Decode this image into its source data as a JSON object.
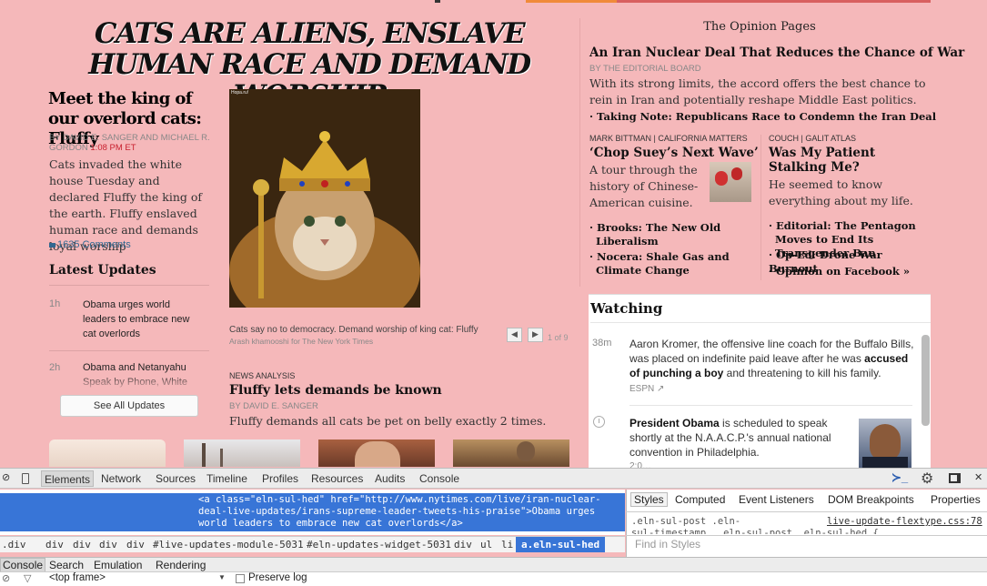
{
  "main_story": {
    "headline": "CATS ARE ALIENS, ENSLAVE HUMAN RACE AND DEMAND WORSHIP",
    "title": "Meet the king of our overlord cats: Fluffy",
    "byline": "By DAVID E. SANGER and MICHAEL R. GORDON",
    "time": "1:08 PM ET",
    "summary": "Cats invaded the white house Tuesday and declared Fluffy the king of the earth. Fluffy enslaved human race and demands loyal worship",
    "comments": "1635 Comments"
  },
  "latest_updates": {
    "heading": "Latest Updates",
    "items": [
      {
        "age": "1h",
        "text": "Obama urges world leaders to embrace new cat overlords"
      },
      {
        "age": "2h",
        "text": "Obama and Netanyahu Speak by Phone, White"
      }
    ],
    "see_all": "See All Updates"
  },
  "photo": {
    "tag": "Hopa.ru!",
    "caption": "Cats say no to democracy. Demand worship of king cat: Fluffy",
    "credit": "Arash khamooshi for The New York Times",
    "prev": "◀",
    "next": "▶",
    "count": "1 of 9"
  },
  "second_story": {
    "kicker": "News Analysis",
    "title": "Fluffy lets demands be known",
    "byline": "By DAVID E. SANGER",
    "summary": "Fluffy demands all cats be pet on belly exactly 2 times."
  },
  "opinion": {
    "heading": "The Opinion Pages",
    "lead_title": "An Iran Nuclear Deal That Reduces the Chance of War",
    "lead_by": "By THE EDITORIAL BOARD",
    "lead_summary": "With its strong limits, the accord offers the best chance to rein in Iran and potentially reshape Middle East politics.",
    "lead_link": "Taking Note: Republicans Race to Condemn the Iran Deal",
    "left_col": {
      "kicker": "Mark Bittman | California Matters",
      "title": "‘Chop Suey’s Next Wave’",
      "summary": "A tour through the history of Chinese-American cuisine.",
      "links": [
        "Brooks: The New Old Liberalism",
        "Nocera: Shale Gas and Climate Change"
      ]
    },
    "right_col": {
      "kicker": "Couch | Galit Atlas",
      "title": "Was My Patient Stalking Me?",
      "summary": "He seemed to know everything about my life.",
      "links": [
        "Editorial: The Pentagon Moves to End Its Transgender Ban",
        "Op-Ed: Drone War Burnout",
        "Opinion on Facebook »"
      ]
    }
  },
  "watching": {
    "heading": "Watching",
    "items": [
      {
        "age": "38m",
        "pre": "Aaron Kromer, the offensive line coach for the Buffalo Bills, was placed on indefinite paid leave after he was ",
        "bold": "accused of punching a boy",
        "post": " and threatening to kill his family.",
        "source": "ESPN ↗"
      },
      {
        "age": "",
        "bold": "President Obama",
        "post": " is scheduled to speak shortly at the N.A.A.C.P.'s annual national convention in Philadelphia.",
        "source": "2:0…"
      }
    ]
  },
  "devtools": {
    "tabs": [
      "Elements",
      "Network",
      "Sources",
      "Timeline",
      "Profiles",
      "Resources",
      "Audits",
      "Console"
    ],
    "selected_html": [
      "<a class=\"eln-sul-hed\" href=\"http://www.nytimes.com/live/iran-nuclear-",
      "deal-live-updates/irans-supreme-leader-tweets-his-praise\">Obama urges",
      "world leaders to embrace new cat overlords</a>"
    ],
    "styles_tabs": [
      "Styles",
      "Computed",
      "Event Listeners",
      "DOM Breakpoints",
      "Properties"
    ],
    "styles_rule": ".eln-sul-post .eln-",
    "styles_rule2": "sul-timestamp, .eln-sul-post .eln-sul-hed {",
    "styles_file": "live-update-flextype.css:78",
    "find_placeholder": "Find in Styles",
    "breadcrumbs": [
      ".div",
      "div",
      "div",
      "div",
      "div",
      "#live-updates-module-5031",
      "#eln-updates-widget-5031",
      "div",
      "ul",
      "li",
      "a.eln-sul-hed"
    ],
    "drawer_tabs": [
      "Console",
      "Search",
      "Emulation",
      "Rendering"
    ],
    "frame": "<top frame>",
    "preserve_log": "Preserve log"
  },
  "colors": {
    "page_bg": "#f5b8ba",
    "link_blue": "#326891",
    "timestamp_red": "#c8202e",
    "devtools_select": "#3875d7"
  }
}
